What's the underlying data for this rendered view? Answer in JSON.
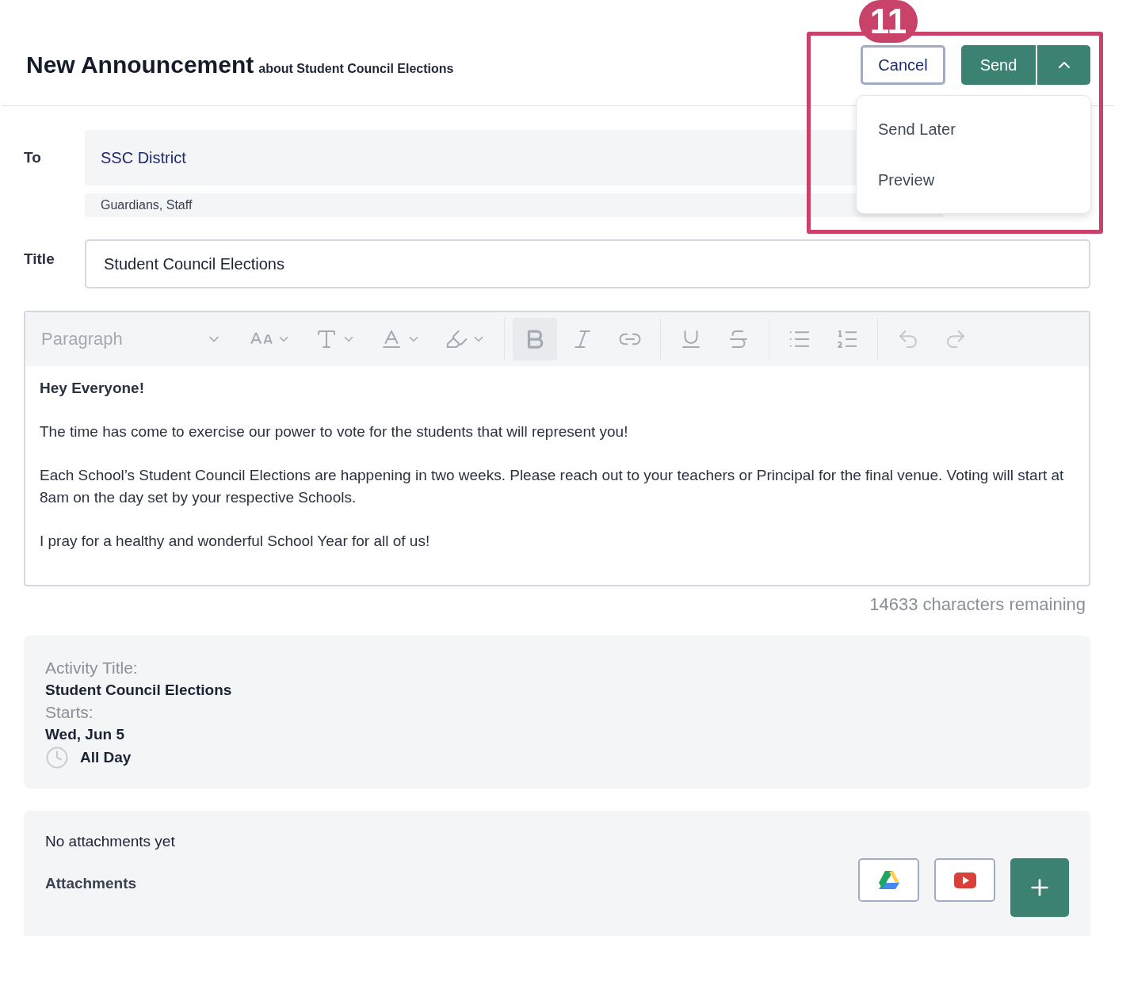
{
  "header": {
    "title": "New Announcement",
    "subtitle": "about Student Council Elections",
    "cancel": "Cancel",
    "send": "Send"
  },
  "annotation": {
    "number": "11"
  },
  "send_menu": {
    "items": [
      {
        "label": "Send Later"
      },
      {
        "label": "Preview"
      }
    ]
  },
  "to": {
    "label": "To",
    "value": "SSC District",
    "audience": "Guardians, Staff"
  },
  "title_field": {
    "label": "Title",
    "value": "Student Council Elections"
  },
  "editor": {
    "toolbar": [
      {
        "kind": "select",
        "value": "Paragraph"
      },
      {
        "kind": "font-size",
        "selected": false,
        "disabled": false
      },
      {
        "kind": "text-format",
        "selected": false,
        "disabled": false
      },
      {
        "kind": "font-color",
        "selected": false,
        "disabled": false
      },
      {
        "kind": "highlight",
        "selected": false,
        "disabled": false
      },
      {
        "kind": "divider"
      },
      {
        "kind": "bold",
        "selected": true,
        "disabled": false
      },
      {
        "kind": "italic",
        "selected": false,
        "disabled": false
      },
      {
        "kind": "link",
        "selected": false,
        "disabled": false
      },
      {
        "kind": "divider"
      },
      {
        "kind": "underline",
        "selected": false,
        "disabled": false
      },
      {
        "kind": "strikethrough",
        "selected": false,
        "disabled": false
      },
      {
        "kind": "divider"
      },
      {
        "kind": "bullet-list",
        "selected": false,
        "disabled": false
      },
      {
        "kind": "numbered-list",
        "selected": false,
        "disabled": false
      },
      {
        "kind": "divider"
      },
      {
        "kind": "undo",
        "selected": false,
        "disabled": true
      },
      {
        "kind": "redo",
        "selected": false,
        "disabled": true
      }
    ],
    "paragraphs": [
      {
        "text": "Hey Everyone!",
        "bold": true
      },
      {
        "text": "The time has come to exercise our power to vote for the students that will represent you!",
        "bold": false
      },
      {
        "text": "Each School’s Student Council Elections are happening in two weeks. Please reach out to your teachers or Principal for the final venue. Voting will start at 8am on the day set by your respective Schools.",
        "bold": false
      },
      {
        "text": "I pray for a healthy and wonderful School Year for all of us!",
        "bold": false
      }
    ]
  },
  "counter": "14633 characters remaining",
  "activity": {
    "title_label": "Activity Title:",
    "title": "Student Council Elections",
    "starts_label": "Starts:",
    "date": "Wed, Jun 5",
    "time": "All Day"
  },
  "attachments": {
    "empty_text": "No attachments yet",
    "label": "Attachments",
    "buttons": [
      {
        "kind": "drive"
      },
      {
        "kind": "video"
      },
      {
        "kind": "add"
      }
    ]
  }
}
